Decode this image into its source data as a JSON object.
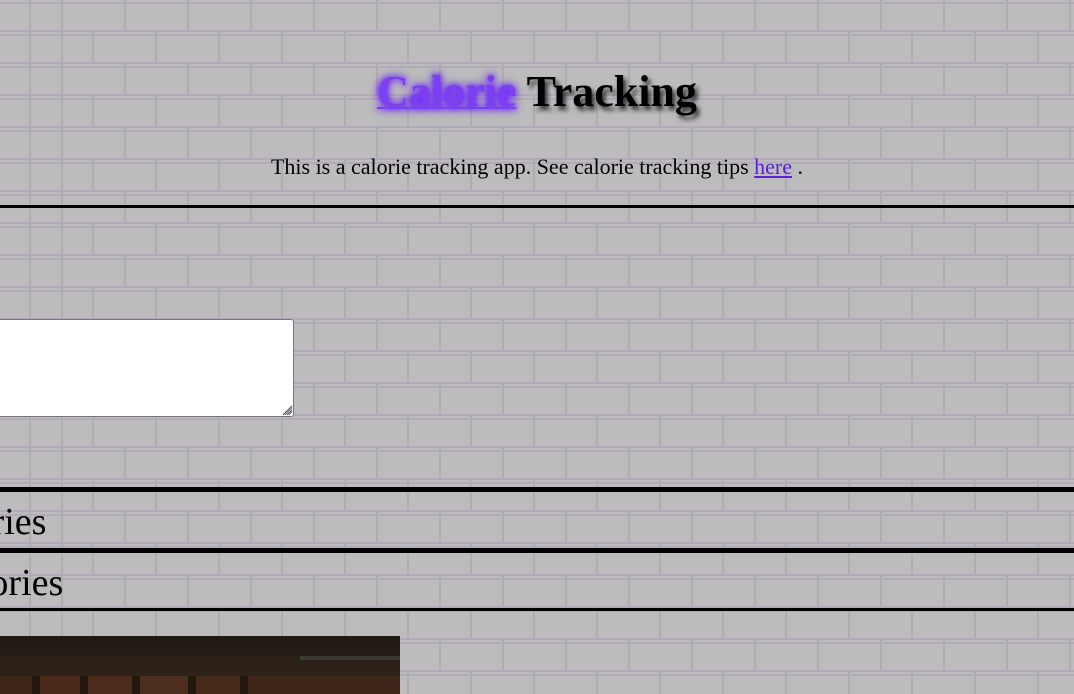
{
  "header": {
    "title_link": "Calorie",
    "title_rest": "Tracking"
  },
  "intro": {
    "text_before": "This is a calorie tracking app. See calorie tracking tips",
    "link_text": "here",
    "text_after": "."
  },
  "notes": {
    "value": "",
    "placeholder": ""
  },
  "sections": {
    "first_heading": "lories",
    "second_heading": "alories"
  },
  "colors": {
    "link": "#5b21d6",
    "title_link_glow": "#6a1cff",
    "background": "#bcbcbc",
    "brick_mortar": "#b2aab8"
  },
  "icons": {
    "resize": "resize-grip-icon"
  }
}
